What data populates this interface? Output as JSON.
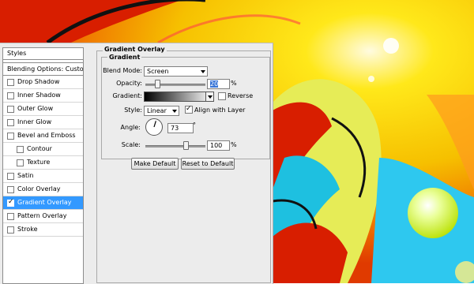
{
  "colors": {
    "selection": "#3399ff",
    "panel": "#ececec",
    "artwork_bg": "#f6d000"
  },
  "styles_panel": {
    "header": "Styles",
    "blending_options": "Blending Options: Custom",
    "items": [
      {
        "label": "Drop Shadow",
        "checked": false
      },
      {
        "label": "Inner Shadow",
        "checked": false
      },
      {
        "label": "Outer Glow",
        "checked": false
      },
      {
        "label": "Inner Glow",
        "checked": false
      },
      {
        "label": "Bevel and Emboss",
        "checked": false
      },
      {
        "label": "Contour",
        "checked": false
      },
      {
        "label": "Texture",
        "checked": false
      },
      {
        "label": "Satin",
        "checked": false
      },
      {
        "label": "Color Overlay",
        "checked": false
      },
      {
        "label": "Gradient Overlay",
        "checked": true
      },
      {
        "label": "Pattern Overlay",
        "checked": false
      },
      {
        "label": "Stroke",
        "checked": false
      }
    ]
  },
  "gradient_overlay": {
    "group_title": "Gradient Overlay",
    "inner_title": "Gradient",
    "blend_mode_label": "Blend Mode:",
    "blend_mode_value": "Screen",
    "opacity_label": "Opacity:",
    "opacity_value": "20",
    "opacity_unit": "%",
    "opacity_level": 0.2,
    "gradient_label": "Gradient:",
    "reverse_label": "Reverse",
    "reverse_checked": false,
    "style_label": "Style:",
    "style_value": "Linear",
    "align_label": "Align with Layer",
    "align_checked": true,
    "angle_label": "Angle:",
    "angle_value": "73",
    "angle_unit": "°",
    "scale_label": "Scale:",
    "scale_value": "100",
    "scale_unit": "%",
    "scale_level": 0.67
  },
  "buttons": {
    "make_default": "Make Default",
    "reset_default": "Reset to Default"
  },
  "icons": {
    "check": "✓",
    "dropdown": "chevron-down-icon"
  }
}
